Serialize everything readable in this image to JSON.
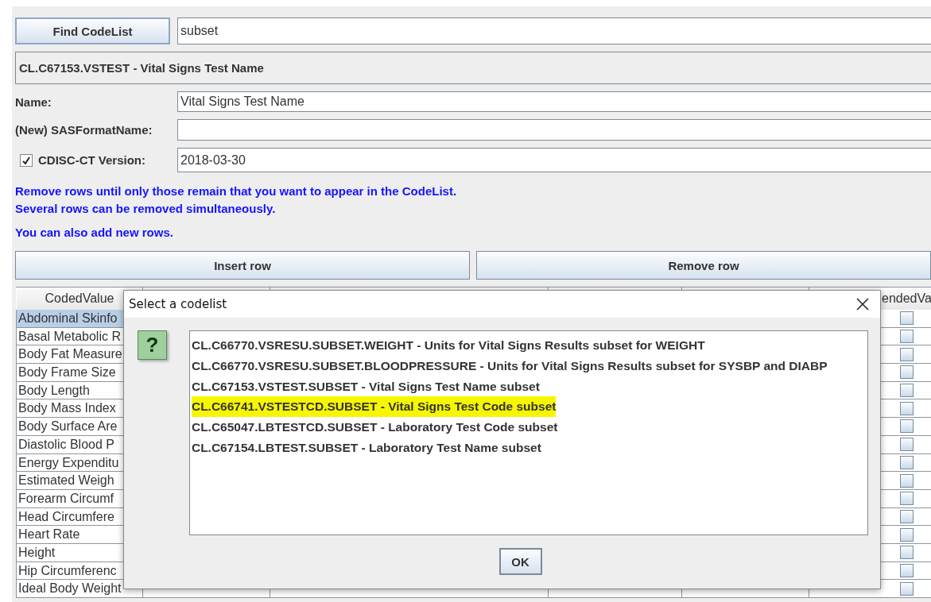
{
  "search": {
    "button": "Find CodeList",
    "value": "subset"
  },
  "codelist_header": "CL.C67153.VSTEST - Vital Signs Test Name",
  "fields": [
    {
      "kind": "text",
      "label": "Name:",
      "value": "Vital Signs Test Name"
    },
    {
      "kind": "text",
      "label": "(New) SASFormatName:"
    },
    {
      "kind": "checkbox",
      "label": "CDISC-CT Version:",
      "value": "2018-03-30",
      "checked": true
    }
  ],
  "instructions": [
    "Remove rows until only those remain that you want to appear in the CodeList.",
    "Several rows can be removed simultaneously.",
    "You can also add new rows."
  ],
  "buttons": [
    "Insert row",
    "Remove row"
  ],
  "table": {
    "column_1": "CodedValue",
    "column_6": "endedVa",
    "rows": [
      {
        "column_1": "Abdominal Skinfo",
        "selected": true,
        "checked": false
      },
      {
        "column_1": "Basal Metabolic R",
        "selected": false,
        "checked": false
      },
      {
        "column_1": "Body Fat Measure",
        "selected": false,
        "checked": false
      },
      {
        "column_1": "Body Frame Size",
        "selected": false,
        "checked": false
      },
      {
        "column_1": "Body Length",
        "selected": false,
        "checked": false
      },
      {
        "column_1": "Body Mass Index",
        "selected": false,
        "checked": false
      },
      {
        "column_1": "Body Surface Are",
        "selected": false,
        "checked": false
      },
      {
        "column_1": "Diastolic Blood P",
        "selected": false,
        "checked": false
      },
      {
        "column_1": "Energy Expenditu",
        "selected": false,
        "checked": false
      },
      {
        "column_1": "Estimated Weigh",
        "selected": false,
        "checked": false
      },
      {
        "column_1": "Forearm Circumf",
        "selected": false,
        "checked": false
      },
      {
        "column_1": "Head Circumfere",
        "selected": false,
        "checked": false
      },
      {
        "column_1": "Heart Rate",
        "selected": false,
        "checked": false
      },
      {
        "column_1": "Height",
        "selected": false,
        "checked": false
      },
      {
        "column_1": "Hip Circumferenc",
        "selected": false,
        "checked": false
      },
      {
        "column_1": "Ideal Body Weight",
        "selected": false,
        "checked": false
      }
    ]
  },
  "dialog": {
    "title": "Select a codelist",
    "icon": "?",
    "items": [
      {
        "label": "CL.C66770.VSRESU.SUBSET.WEIGHT - Units for Vital Signs Results subset for WEIGHT",
        "highlighted": false
      },
      {
        "label": "CL.C66770.VSRESU.SUBSET.BLOODPRESSURE - Units for Vital Signs Results subset for SYSBP and DIABP",
        "highlighted": false
      },
      {
        "label": "CL.C67153.VSTEST.SUBSET - Vital Signs Test Name subset",
        "highlighted": false
      },
      {
        "label": "CL.C66741.VSTESTCD.SUBSET - Vital Signs Test Code subset",
        "highlighted": true
      },
      {
        "label": "CL.C65047.LBTESTCD.SUBSET - Laboratory Test Code subset",
        "highlighted": false
      },
      {
        "label": "CL.C67154.LBTEST.SUBSET - Laboratory Test Name subset",
        "highlighted": false
      }
    ],
    "button": "OK"
  }
}
